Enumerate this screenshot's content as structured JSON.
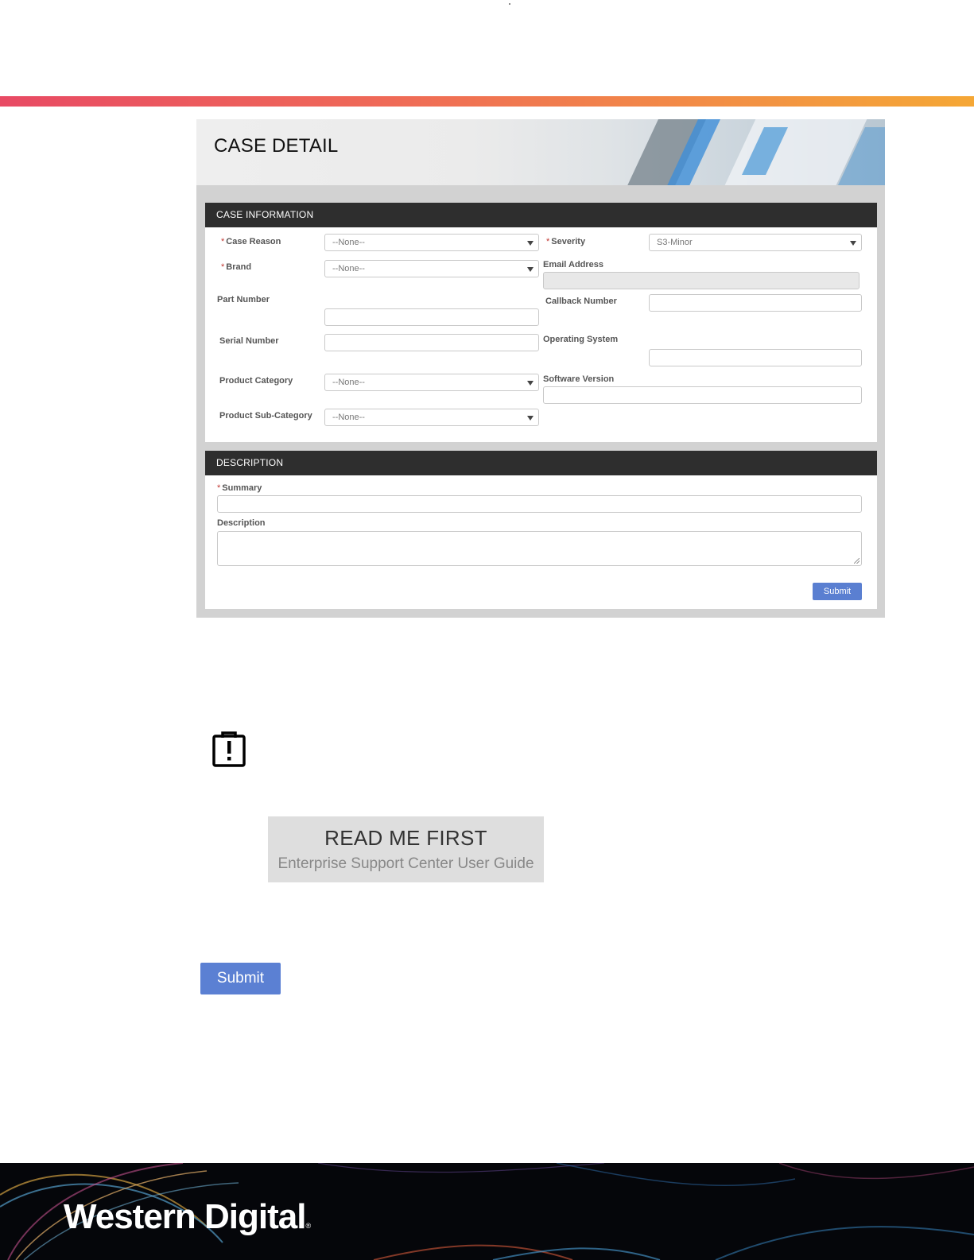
{
  "case_detail": {
    "title": "CASE DETAIL",
    "case_information": {
      "header": "CASE INFORMATION",
      "required_marker": "*",
      "case_reason": {
        "label": "Case Reason",
        "value": "--None--"
      },
      "brand": {
        "label": "Brand",
        "value": "--None--"
      },
      "part_number": {
        "label": "Part Number",
        "value": ""
      },
      "serial_number": {
        "label": "Serial Number",
        "value": ""
      },
      "product_category": {
        "label": "Product Category",
        "value": "--None--"
      },
      "product_sub_category": {
        "label": "Product Sub-Category",
        "value": "--None--"
      },
      "severity": {
        "label": "Severity",
        "value": "S3-Minor"
      },
      "email_address": {
        "label": "Email Address",
        "value": ""
      },
      "callback_number": {
        "label": "Callback Number",
        "value": ""
      },
      "operating_system": {
        "label": "Operating System",
        "value": ""
      },
      "software_version": {
        "label": "Software Version",
        "value": ""
      }
    },
    "description_section": {
      "header": "DESCRIPTION",
      "summary": {
        "label": "Summary",
        "value": ""
      },
      "description": {
        "label": "Description",
        "value": ""
      },
      "submit_label": "Submit"
    }
  },
  "alert_icon": "clipboard-alert-icon",
  "read_me": {
    "title": "READ ME FIRST",
    "subtitle": "Enterprise Support Center User Guide"
  },
  "submit_button": {
    "label": "Submit"
  },
  "footer": {
    "brand": "Western Digital",
    "trademark": "®"
  },
  "colors": {
    "accent_gradient_start": "#e84a64",
    "accent_gradient_end": "#f5a735",
    "submit_blue": "#5b80d3",
    "section_bar": "#2e2e2e",
    "required": "#c23934"
  }
}
